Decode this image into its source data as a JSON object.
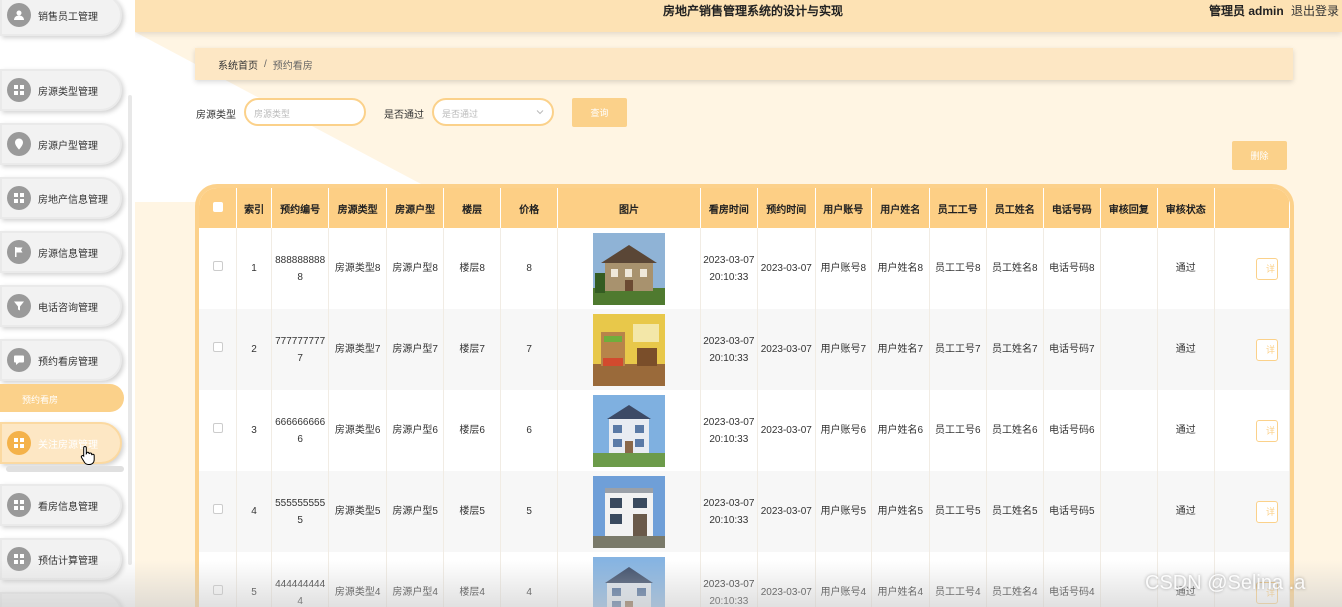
{
  "header": {
    "app_title": "房地产销售管理系统的设计与实现",
    "admin_label": "管理员 admin",
    "logout_label": "退出登录"
  },
  "sidebar": {
    "items": [
      {
        "label": "销售员工管理",
        "icon": "user-icon"
      },
      {
        "label": "房源类型管理",
        "icon": "grid-icon"
      },
      {
        "label": "房源户型管理",
        "icon": "pin-icon"
      },
      {
        "label": "房地产信息管理",
        "icon": "grid-icon"
      },
      {
        "label": "房源信息管理",
        "icon": "flag-icon"
      },
      {
        "label": "电话咨询管理",
        "icon": "funnel-icon"
      },
      {
        "label": "预约看房管理",
        "icon": "chat-icon"
      },
      {
        "label": "关注房源管理",
        "icon": "grid-icon"
      },
      {
        "label": "看房信息管理",
        "icon": "grid-icon"
      },
      {
        "label": "预估计算管理",
        "icon": "grid-icon"
      }
    ],
    "sub_item": "预约看房"
  },
  "breadcrumb": {
    "home": "系统首页",
    "separator": "/",
    "current": "预约看房"
  },
  "search": {
    "type_label": "房源类型",
    "type_placeholder": "房源类型",
    "pass_label": "是否通过",
    "pass_placeholder": "是否通过",
    "query_label": "查询",
    "delete_label": "删除"
  },
  "table": {
    "columns": [
      "索引",
      "预约编号",
      "房源类型",
      "房源户型",
      "楼层",
      "价格",
      "图片",
      "看房时间",
      "预约时间",
      "用户账号",
      "用户姓名",
      "员工工号",
      "员工姓名",
      "电话号码",
      "审核回复",
      "审核状态"
    ],
    "rows": [
      {
        "index": "1",
        "booking_no": "8888888888",
        "house_type": "房源类型8",
        "layout": "房源户型8",
        "floor": "楼层8",
        "price": "8",
        "view_time": "2023-03-07 20:10:33",
        "booking_time": "2023-03-07",
        "account": "用户账号8",
        "user_name": "用户姓名8",
        "staff_no": "员工工号8",
        "staff_name": "员工姓名8",
        "phone": "电话号码8",
        "reply": "",
        "status": "通过",
        "detail": "详"
      },
      {
        "index": "2",
        "booking_no": "7777777777",
        "house_type": "房源类型7",
        "layout": "房源户型7",
        "floor": "楼层7",
        "price": "7",
        "view_time": "2023-03-07 20:10:33",
        "booking_time": "2023-03-07",
        "account": "用户账号7",
        "user_name": "用户姓名7",
        "staff_no": "员工工号7",
        "staff_name": "员工姓名7",
        "phone": "电话号码7",
        "reply": "",
        "status": "通过",
        "detail": "详"
      },
      {
        "index": "3",
        "booking_no": "6666666666",
        "house_type": "房源类型6",
        "layout": "房源户型6",
        "floor": "楼层6",
        "price": "6",
        "view_time": "2023-03-07 20:10:33",
        "booking_time": "2023-03-07",
        "account": "用户账号6",
        "user_name": "用户姓名6",
        "staff_no": "员工工号6",
        "staff_name": "员工姓名6",
        "phone": "电话号码6",
        "reply": "",
        "status": "通过",
        "detail": "详"
      },
      {
        "index": "4",
        "booking_no": "5555555555",
        "house_type": "房源类型5",
        "layout": "房源户型5",
        "floor": "楼层5",
        "price": "5",
        "view_time": "2023-03-07 20:10:33",
        "booking_time": "2023-03-07",
        "account": "用户账号5",
        "user_name": "用户姓名5",
        "staff_no": "员工工号5",
        "staff_name": "员工姓名5",
        "phone": "电话号码5",
        "reply": "",
        "status": "通过",
        "detail": "详"
      },
      {
        "index": "5",
        "booking_no": "4444444444",
        "house_type": "房源类型4",
        "layout": "房源户型4",
        "floor": "楼层4",
        "price": "4",
        "view_time": "2023-03-07 20:10:33",
        "booking_time": "2023-03-07",
        "account": "用户账号4",
        "user_name": "用户姓名4",
        "staff_no": "员工工号4",
        "staff_name": "员工姓名4",
        "phone": "电话号码4",
        "reply": "",
        "status": "通过",
        "detail": "详"
      }
    ]
  },
  "watermark": "CSDN @Selina .a",
  "colors": {
    "accent": "#fbd18a",
    "header_bg": "#fde2b4",
    "table_header": "#fdcf85",
    "page_bg": "#fff5e3"
  }
}
